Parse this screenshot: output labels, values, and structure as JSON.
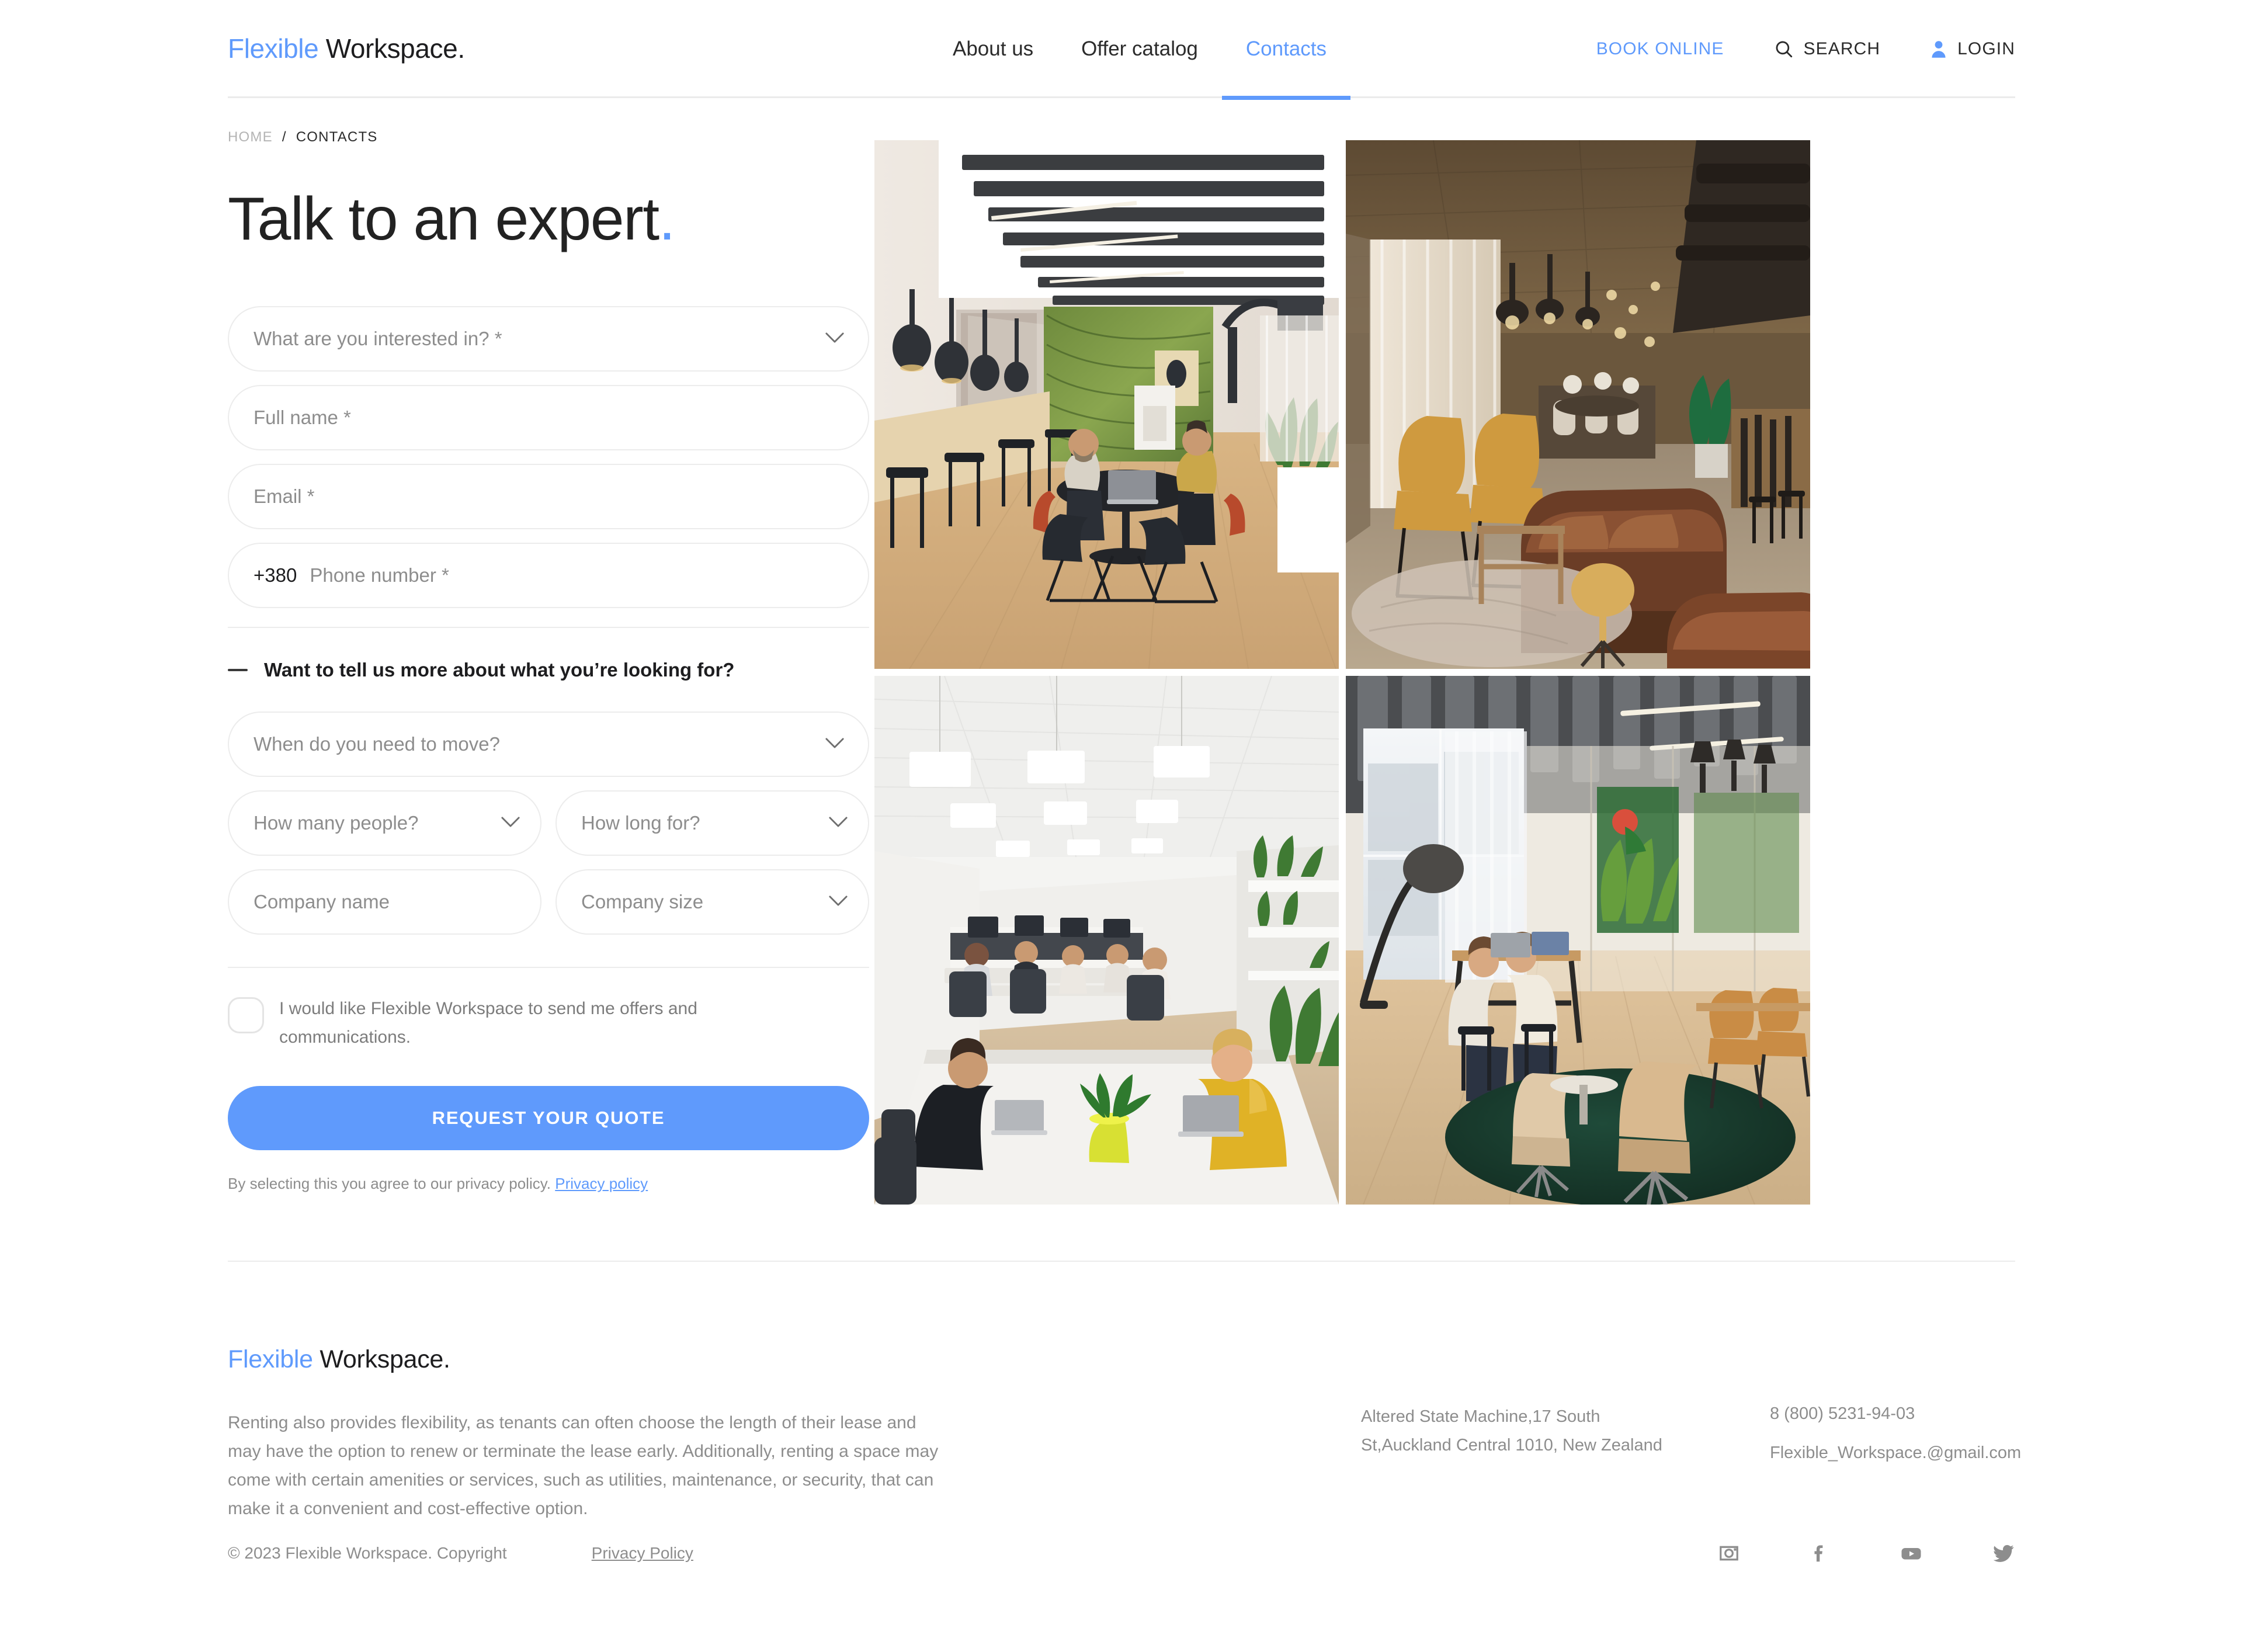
{
  "brand": {
    "accent_word": "Flexible",
    "rest_word": " Workspace",
    "dot": ".",
    "accent_color": "#5f9afc"
  },
  "header": {
    "nav": [
      {
        "label": "About us",
        "active": false
      },
      {
        "label": "Offer catalog",
        "active": false
      },
      {
        "label": "Contacts",
        "active": true
      }
    ],
    "book_online": "BOOK ONLINE",
    "search": "SEARCH",
    "login": "LOGIN"
  },
  "breadcrumb": {
    "home": "HOME",
    "separator": "/",
    "current": "CONTACTS"
  },
  "page_title": {
    "text": "Talk to an expert",
    "dot": "."
  },
  "form": {
    "interest_placeholder": "What are you interested in? *",
    "fullname_placeholder": "Full name *",
    "email_placeholder": "Email *",
    "phone_prefix": "+380",
    "phone_placeholder": "Phone number *",
    "more_label": "Want to tell us more about what you’re looking for?",
    "move_placeholder": "When do you need to move?",
    "people_placeholder": "How many people?",
    "duration_placeholder": "How long for?",
    "company_name_placeholder": "Company name",
    "company_size_placeholder": "Company size",
    "consent_text": "I would like Flexible Workspace to send me offers and communications.",
    "submit_label": "REQUEST YOUR QUOTE",
    "privacy_note": "By selecting this you agree to our privacy policy.",
    "privacy_link": "Privacy policy"
  },
  "gallery": [
    {
      "alt": "coworking-space-with-acoustic-baffles"
    },
    {
      "alt": "warm-lounge-with-leather-sofas"
    },
    {
      "alt": "bright-open-plan-office"
    },
    {
      "alt": "lounge-with-green-rug-and-plants"
    }
  ],
  "footer": {
    "description": "Renting also provides flexibility, as tenants can often choose the length of their lease and may have the option to renew or terminate the lease early. Additionally, renting a space may come with certain amenities or services, such as utilities, maintenance, or security, that can make it a convenient and cost-effective option.",
    "address_line1": "Altered State Machine,17 South",
    "address_line2": "St,Auckland Central 1010, New Zealand",
    "phone": "8 (800) 5231-94-03",
    "email": "Flexible_Workspace.@gmail.com",
    "copyright": "© 2023 Flexible Workspace. Copyright",
    "privacy_policy": "Privacy Policy",
    "socials": [
      "instagram-icon",
      "facebook-icon",
      "youtube-icon",
      "twitter-icon"
    ]
  }
}
